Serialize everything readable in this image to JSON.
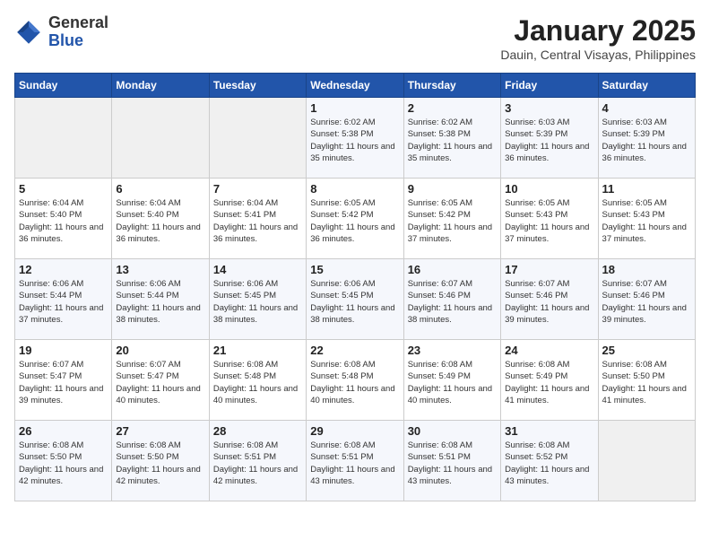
{
  "header": {
    "logo_general": "General",
    "logo_blue": "Blue",
    "month_title": "January 2025",
    "location": "Dauin, Central Visayas, Philippines"
  },
  "weekdays": [
    "Sunday",
    "Monday",
    "Tuesday",
    "Wednesday",
    "Thursday",
    "Friday",
    "Saturday"
  ],
  "weeks": [
    [
      {
        "day": "",
        "sunrise": "",
        "sunset": "",
        "daylight": ""
      },
      {
        "day": "",
        "sunrise": "",
        "sunset": "",
        "daylight": ""
      },
      {
        "day": "",
        "sunrise": "",
        "sunset": "",
        "daylight": ""
      },
      {
        "day": "1",
        "sunrise": "Sunrise: 6:02 AM",
        "sunset": "Sunset: 5:38 PM",
        "daylight": "Daylight: 11 hours and 35 minutes."
      },
      {
        "day": "2",
        "sunrise": "Sunrise: 6:02 AM",
        "sunset": "Sunset: 5:38 PM",
        "daylight": "Daylight: 11 hours and 35 minutes."
      },
      {
        "day": "3",
        "sunrise": "Sunrise: 6:03 AM",
        "sunset": "Sunset: 5:39 PM",
        "daylight": "Daylight: 11 hours and 36 minutes."
      },
      {
        "day": "4",
        "sunrise": "Sunrise: 6:03 AM",
        "sunset": "Sunset: 5:39 PM",
        "daylight": "Daylight: 11 hours and 36 minutes."
      }
    ],
    [
      {
        "day": "5",
        "sunrise": "Sunrise: 6:04 AM",
        "sunset": "Sunset: 5:40 PM",
        "daylight": "Daylight: 11 hours and 36 minutes."
      },
      {
        "day": "6",
        "sunrise": "Sunrise: 6:04 AM",
        "sunset": "Sunset: 5:40 PM",
        "daylight": "Daylight: 11 hours and 36 minutes."
      },
      {
        "day": "7",
        "sunrise": "Sunrise: 6:04 AM",
        "sunset": "Sunset: 5:41 PM",
        "daylight": "Daylight: 11 hours and 36 minutes."
      },
      {
        "day": "8",
        "sunrise": "Sunrise: 6:05 AM",
        "sunset": "Sunset: 5:42 PM",
        "daylight": "Daylight: 11 hours and 36 minutes."
      },
      {
        "day": "9",
        "sunrise": "Sunrise: 6:05 AM",
        "sunset": "Sunset: 5:42 PM",
        "daylight": "Daylight: 11 hours and 37 minutes."
      },
      {
        "day": "10",
        "sunrise": "Sunrise: 6:05 AM",
        "sunset": "Sunset: 5:43 PM",
        "daylight": "Daylight: 11 hours and 37 minutes."
      },
      {
        "day": "11",
        "sunrise": "Sunrise: 6:05 AM",
        "sunset": "Sunset: 5:43 PM",
        "daylight": "Daylight: 11 hours and 37 minutes."
      }
    ],
    [
      {
        "day": "12",
        "sunrise": "Sunrise: 6:06 AM",
        "sunset": "Sunset: 5:44 PM",
        "daylight": "Daylight: 11 hours and 37 minutes."
      },
      {
        "day": "13",
        "sunrise": "Sunrise: 6:06 AM",
        "sunset": "Sunset: 5:44 PM",
        "daylight": "Daylight: 11 hours and 38 minutes."
      },
      {
        "day": "14",
        "sunrise": "Sunrise: 6:06 AM",
        "sunset": "Sunset: 5:45 PM",
        "daylight": "Daylight: 11 hours and 38 minutes."
      },
      {
        "day": "15",
        "sunrise": "Sunrise: 6:06 AM",
        "sunset": "Sunset: 5:45 PM",
        "daylight": "Daylight: 11 hours and 38 minutes."
      },
      {
        "day": "16",
        "sunrise": "Sunrise: 6:07 AM",
        "sunset": "Sunset: 5:46 PM",
        "daylight": "Daylight: 11 hours and 38 minutes."
      },
      {
        "day": "17",
        "sunrise": "Sunrise: 6:07 AM",
        "sunset": "Sunset: 5:46 PM",
        "daylight": "Daylight: 11 hours and 39 minutes."
      },
      {
        "day": "18",
        "sunrise": "Sunrise: 6:07 AM",
        "sunset": "Sunset: 5:46 PM",
        "daylight": "Daylight: 11 hours and 39 minutes."
      }
    ],
    [
      {
        "day": "19",
        "sunrise": "Sunrise: 6:07 AM",
        "sunset": "Sunset: 5:47 PM",
        "daylight": "Daylight: 11 hours and 39 minutes."
      },
      {
        "day": "20",
        "sunrise": "Sunrise: 6:07 AM",
        "sunset": "Sunset: 5:47 PM",
        "daylight": "Daylight: 11 hours and 40 minutes."
      },
      {
        "day": "21",
        "sunrise": "Sunrise: 6:08 AM",
        "sunset": "Sunset: 5:48 PM",
        "daylight": "Daylight: 11 hours and 40 minutes."
      },
      {
        "day": "22",
        "sunrise": "Sunrise: 6:08 AM",
        "sunset": "Sunset: 5:48 PM",
        "daylight": "Daylight: 11 hours and 40 minutes."
      },
      {
        "day": "23",
        "sunrise": "Sunrise: 6:08 AM",
        "sunset": "Sunset: 5:49 PM",
        "daylight": "Daylight: 11 hours and 40 minutes."
      },
      {
        "day": "24",
        "sunrise": "Sunrise: 6:08 AM",
        "sunset": "Sunset: 5:49 PM",
        "daylight": "Daylight: 11 hours and 41 minutes."
      },
      {
        "day": "25",
        "sunrise": "Sunrise: 6:08 AM",
        "sunset": "Sunset: 5:50 PM",
        "daylight": "Daylight: 11 hours and 41 minutes."
      }
    ],
    [
      {
        "day": "26",
        "sunrise": "Sunrise: 6:08 AM",
        "sunset": "Sunset: 5:50 PM",
        "daylight": "Daylight: 11 hours and 42 minutes."
      },
      {
        "day": "27",
        "sunrise": "Sunrise: 6:08 AM",
        "sunset": "Sunset: 5:50 PM",
        "daylight": "Daylight: 11 hours and 42 minutes."
      },
      {
        "day": "28",
        "sunrise": "Sunrise: 6:08 AM",
        "sunset": "Sunset: 5:51 PM",
        "daylight": "Daylight: 11 hours and 42 minutes."
      },
      {
        "day": "29",
        "sunrise": "Sunrise: 6:08 AM",
        "sunset": "Sunset: 5:51 PM",
        "daylight": "Daylight: 11 hours and 43 minutes."
      },
      {
        "day": "30",
        "sunrise": "Sunrise: 6:08 AM",
        "sunset": "Sunset: 5:51 PM",
        "daylight": "Daylight: 11 hours and 43 minutes."
      },
      {
        "day": "31",
        "sunrise": "Sunrise: 6:08 AM",
        "sunset": "Sunset: 5:52 PM",
        "daylight": "Daylight: 11 hours and 43 minutes."
      },
      {
        "day": "",
        "sunrise": "",
        "sunset": "",
        "daylight": ""
      }
    ]
  ]
}
